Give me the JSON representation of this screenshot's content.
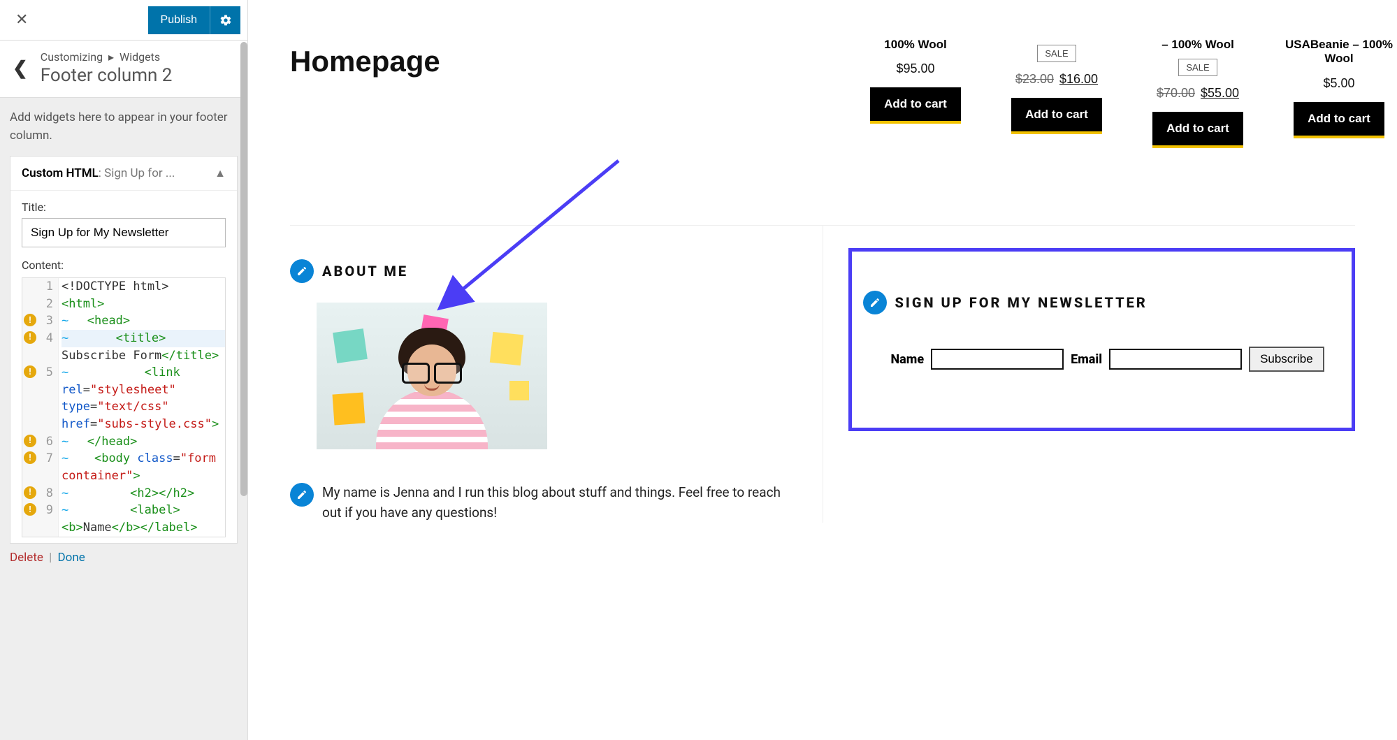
{
  "sidebar": {
    "publish": "Publish",
    "crumb_customizing": "Customizing",
    "crumb_widgets": "Widgets",
    "crumb_title": "Footer column 2",
    "desc": "Add widgets here to appear in your footer column.",
    "widget_head_bold": "Custom HTML",
    "widget_head_grey": ": Sign Up for ...",
    "title_label": "Title:",
    "title_value": "Sign Up for My Newsletter",
    "content_label": "Content:",
    "code": [
      {
        "n": "1",
        "warn": false,
        "segs": [
          {
            "t": "<!DOCTYPE html>",
            "c": "tok-default"
          }
        ]
      },
      {
        "n": "2",
        "warn": false,
        "segs": [
          {
            "t": "<html>",
            "c": "tok-tag"
          }
        ]
      },
      {
        "n": "3",
        "warn": true,
        "segs": [
          {
            "t": "~",
            "c": "tok-tilde"
          },
          {
            "t": "  ",
            "c": ""
          },
          {
            "t": "<head>",
            "c": "tok-tag"
          }
        ]
      },
      {
        "n": "4",
        "warn": true,
        "active": true,
        "segs": [
          {
            "t": "~",
            "c": "tok-tilde"
          },
          {
            "t": "      ",
            "c": ""
          },
          {
            "t": "<title>",
            "c": "tok-tag"
          }
        ]
      },
      {
        "n": "",
        "warn": false,
        "cont": true,
        "segs": [
          {
            "t": "Subscribe Form",
            "c": "tok-default"
          },
          {
            "t": "</title>",
            "c": "tok-tag"
          }
        ]
      },
      {
        "n": "5",
        "warn": true,
        "segs": [
          {
            "t": "~",
            "c": "tok-tilde"
          },
          {
            "t": "          ",
            "c": ""
          },
          {
            "t": "<link",
            "c": "tok-tag"
          }
        ]
      },
      {
        "n": "",
        "warn": false,
        "cont": true,
        "segs": [
          {
            "t": "rel",
            "c": "tok-attr"
          },
          {
            "t": "=",
            "c": "tok-default"
          },
          {
            "t": "\"stylesheet\"",
            "c": "tok-str"
          }
        ]
      },
      {
        "n": "",
        "warn": false,
        "cont": true,
        "segs": [
          {
            "t": "type",
            "c": "tok-attr"
          },
          {
            "t": "=",
            "c": "tok-default"
          },
          {
            "t": "\"text/css\"",
            "c": "tok-str"
          }
        ]
      },
      {
        "n": "",
        "warn": false,
        "cont": true,
        "segs": [
          {
            "t": "href",
            "c": "tok-attr"
          },
          {
            "t": "=",
            "c": "tok-default"
          },
          {
            "t": "\"subs-style.css\"",
            "c": "tok-str"
          },
          {
            "t": ">",
            "c": "tok-tag"
          }
        ]
      },
      {
        "n": "6",
        "warn": true,
        "segs": [
          {
            "t": "~",
            "c": "tok-tilde"
          },
          {
            "t": "  ",
            "c": ""
          },
          {
            "t": "</head>",
            "c": "tok-tag"
          }
        ]
      },
      {
        "n": "7",
        "warn": true,
        "segs": [
          {
            "t": "~",
            "c": "tok-tilde"
          },
          {
            "t": "   ",
            "c": ""
          },
          {
            "t": "<body ",
            "c": "tok-tag"
          },
          {
            "t": "class",
            "c": "tok-attr"
          },
          {
            "t": "=",
            "c": "tok-default"
          },
          {
            "t": "\"form",
            "c": "tok-str"
          }
        ]
      },
      {
        "n": "",
        "warn": false,
        "cont": true,
        "segs": [
          {
            "t": "container\"",
            "c": "tok-str"
          },
          {
            "t": ">",
            "c": "tok-tag"
          }
        ]
      },
      {
        "n": "8",
        "warn": true,
        "segs": [
          {
            "t": "~",
            "c": "tok-tilde"
          },
          {
            "t": "        ",
            "c": ""
          },
          {
            "t": "<h2></h2>",
            "c": "tok-tag"
          }
        ]
      },
      {
        "n": "9",
        "warn": true,
        "segs": [
          {
            "t": "~",
            "c": "tok-tilde"
          },
          {
            "t": "        ",
            "c": ""
          },
          {
            "t": "<label>",
            "c": "tok-tag"
          }
        ]
      },
      {
        "n": "",
        "warn": false,
        "cont": true,
        "segs": [
          {
            "t": "<b>",
            "c": "tok-tag"
          },
          {
            "t": "Name",
            "c": "tok-default"
          },
          {
            "t": "</b></label>",
            "c": "tok-tag"
          }
        ]
      }
    ],
    "delete": "Delete",
    "done": "Done"
  },
  "preview": {
    "h1": "Homepage",
    "products": [
      {
        "title": "100% Wool",
        "sale": false,
        "old": "",
        "new": "$95.00",
        "btn": "Add to cart"
      },
      {
        "title": "",
        "sale": true,
        "old": "$23.00",
        "new": "$16.00",
        "btn": "Add to cart"
      },
      {
        "title": "– 100% Wool",
        "sale": true,
        "old": "$70.00",
        "new": "$55.00",
        "btn": "Add to cart"
      },
      {
        "title": "USABeanie – 100% Wool",
        "sale": false,
        "old": "",
        "new": "$5.00",
        "btn": "Add to cart"
      }
    ],
    "sale_label": "SALE",
    "about_title": "ABOUT ME",
    "about_text": "My name is Jenna and I run this blog about stuff and things. Feel free to reach out if you have any questions!",
    "news_title": "SIGN UP FOR MY NEWSLETTER",
    "name_label": "Name",
    "email_label": "Email",
    "subscribe": "Subscribe"
  }
}
